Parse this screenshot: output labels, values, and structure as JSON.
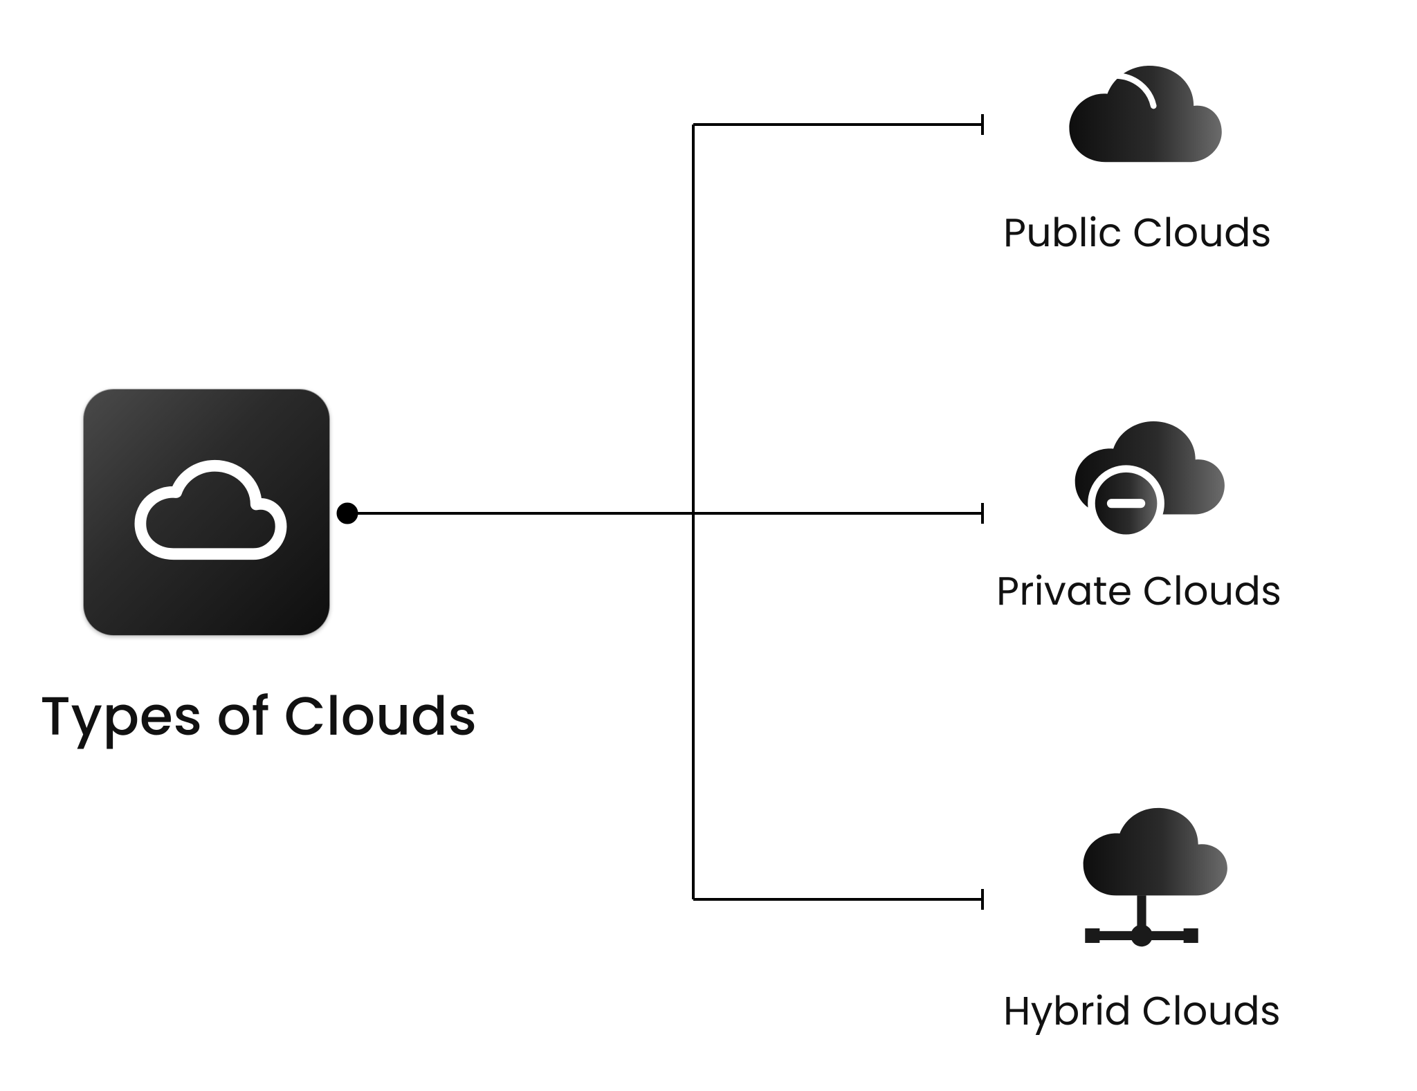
{
  "root": {
    "title": "Types of Clouds"
  },
  "leaves": {
    "public": {
      "label": "Public Clouds"
    },
    "private": {
      "label": "Private Clouds"
    },
    "hybrid": {
      "label": "Hybrid Clouds"
    }
  }
}
